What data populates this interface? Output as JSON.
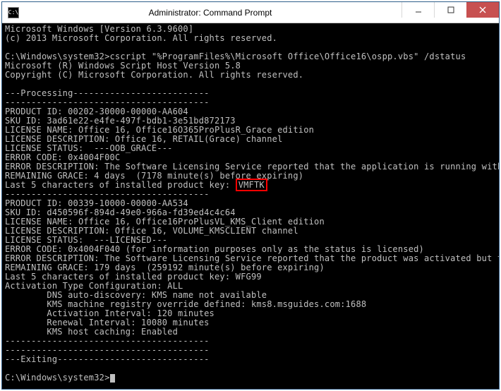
{
  "window": {
    "title": "Administrator: Command Prompt",
    "icon_glyph": "C:\\"
  },
  "buttons": {
    "minimize": "minimize",
    "maximize": "maximize",
    "close": "close"
  },
  "console": {
    "l1": "Microsoft Windows [Version 6.3.9600]",
    "l2": "(c) 2013 Microsoft Corporation. All rights reserved.",
    "l3": "",
    "l4a": "C:\\Windows\\system32>",
    "l4b": "cscript \"%ProgramFiles%\\Microsoft Office\\Office16\\ospp.vbs\" /dstatus",
    "l5": "Microsoft (R) Windows Script Host Version 5.8",
    "l6": "Copyright (C) Microsoft Corporation. All rights reserved.",
    "l7": "",
    "l8": "---Processing--------------------------",
    "l9": "---------------------------------------",
    "l10": "PRODUCT ID: 00202-30000-00000-AA604",
    "l11": "SKU ID: 3ad61e22-e4fe-497f-bdb1-3e51bd872173",
    "l12": "LICENSE NAME: Office 16, Office16O365ProPlusR_Grace edition",
    "l13": "LICENSE DESCRIPTION: Office 16, RETAIL(Grace) channel",
    "l14": "LICENSE STATUS:  ---OOB_GRACE---",
    "l15": "ERROR CODE: 0x4004F00C",
    "l16": "ERROR DESCRIPTION: The Software Licensing Service reported that the application is running within the valid grace period.",
    "l17": "REMAINING GRACE: 4 days  (7178 minute(s) before expiring)",
    "l18a": "Last 5 characters of installed product key: ",
    "l18hl": "VMFTK",
    "l19": "---------------------------------------",
    "l20": "PRODUCT ID: 00339-10000-00000-AA534",
    "l21": "SKU ID: d450596f-894d-49e0-966a-fd39ed4c4c64",
    "l22": "LICENSE NAME: Office 16, Office16ProPlusVL_KMS_Client edition",
    "l23": "LICENSE DESCRIPTION: Office 16, VOLUME_KMSCLIENT channel",
    "l24": "LICENSE STATUS:  ---LICENSED---",
    "l25": "ERROR CODE: 0x4004F040 (for information purposes only as the status is licensed)",
    "l26": "ERROR DESCRIPTION: The Software Licensing Service reported that the product was activated but the owner should verify the Product Use Rights.",
    "l27": "REMAINING GRACE: 179 days  (259192 minute(s) before expiring)",
    "l28": "Last 5 characters of installed product key: WFG99",
    "l29": "Activation Type Configuration: ALL",
    "l30": "        DNS auto-discovery: KMS name not available",
    "l31": "        KMS machine registry override defined: kms8.msguides.com:1688",
    "l32": "        Activation Interval: 120 minutes",
    "l33": "        Renewal Interval: 10080 minutes",
    "l34": "        KMS host caching: Enabled",
    "l35": "---------------------------------------",
    "l36": "---------------------------------------",
    "l37": "---Exiting-----------------------------",
    "l38": "",
    "l39": "C:\\Windows\\system32>"
  }
}
